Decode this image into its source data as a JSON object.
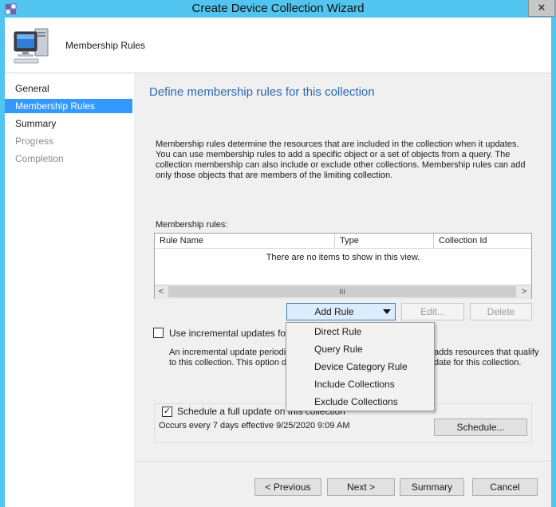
{
  "window": {
    "title": "Create Device Collection Wizard",
    "close_glyph": "✕"
  },
  "header": {
    "title": "Membership Rules"
  },
  "nav": {
    "items": [
      {
        "label": "General",
        "state": "normal"
      },
      {
        "label": "Membership Rules",
        "state": "selected"
      },
      {
        "label": "Summary",
        "state": "normal"
      },
      {
        "label": "Progress",
        "state": "disabled"
      },
      {
        "label": "Completion",
        "state": "disabled"
      }
    ]
  },
  "main": {
    "heading": "Define membership rules for this collection",
    "description": "Membership rules determine the resources that are included in the collection when it updates. You can use membership rules to add a specific object or a set of objects from a query. The collection membership can also include or exclude other collections. Membership rules can add only those objects that are members of the limiting collection.",
    "rules_label": "Membership rules:",
    "columns": [
      "Rule Name",
      "Type",
      "Collection Id"
    ],
    "empty_message": "There are no items to show in this view.",
    "scroll": {
      "left": "<",
      "thumb": "III",
      "right": ">"
    },
    "buttons": {
      "add_rule": "Add Rule",
      "edit": "Edit...",
      "delete": "Delete"
    },
    "incremental": {
      "label": "Use incremental updates for thi",
      "checked": false,
      "desc_line1_left": "An incremental update periodic",
      "desc_line1_right": "adds resources that qualify",
      "desc_line2_left": "to this collection. This option do",
      "desc_line2_right": "date for this collection."
    },
    "full_update": {
      "label": "Schedule a full update on this collection",
      "checked": true,
      "check_glyph": "✓",
      "occurs": "Occurs every 7 days effective 9/25/2020 9:09 AM",
      "schedule_button": "Schedule..."
    }
  },
  "menu": {
    "items": [
      "Direct Rule",
      "Query Rule",
      "Device Category Rule",
      "Include Collections",
      "Exclude Collections"
    ]
  },
  "footer": {
    "previous": "< Previous",
    "next": "Next >",
    "summary": "Summary",
    "cancel": "Cancel"
  },
  "colors": {
    "title_bar": "#51c4ef",
    "selected_nav": "#3399ff",
    "heading": "#2a6ab0"
  }
}
